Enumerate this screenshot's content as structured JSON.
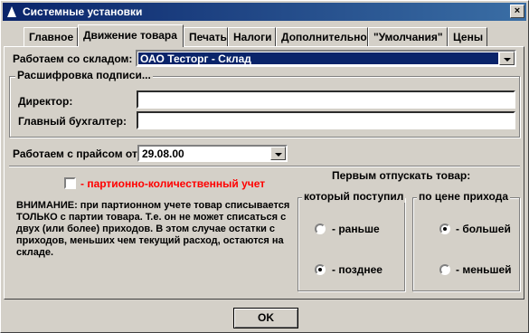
{
  "window": {
    "title": "Системные установки",
    "close_glyph": "×"
  },
  "tabs": [
    {
      "label": "Главное"
    },
    {
      "label": "Движение товара",
      "active": true
    },
    {
      "label": "Печать"
    },
    {
      "label": "Налоги"
    },
    {
      "label": "Дополнительно"
    },
    {
      "label": "\"Умолчания\""
    },
    {
      "label": "Цены"
    }
  ],
  "warehouse": {
    "label": "Работаем со складом:",
    "value": "ОАО Тесторг - Склад"
  },
  "signatures": {
    "legend": "Расшифровка подписи...",
    "director_label": "Директор:",
    "director_value": "",
    "accountant_label": "Главный бухгалтер:",
    "accountant_value": ""
  },
  "pricelist": {
    "label": "Работаем с прайсом от:",
    "value": "29.08.00"
  },
  "batch": {
    "label": "- партионно-количественный учет",
    "checked": false,
    "label_color": "#ff0000"
  },
  "note": "ВНИМАНИЕ: при партионном учете товар списывается ТОЛЬКО с партии товара. Т.е. он не может списаться с двух (или более) приходов. В этом случае остатки с приходов, меньших чем текущий расход, остаются на складе.",
  "release_first": {
    "heading": "Первым отпускать товар:",
    "arrival_group": {
      "legend": "который поступил",
      "options": [
        {
          "label": "- раньше",
          "checked": false
        },
        {
          "label": "- позднее",
          "checked": true
        }
      ]
    },
    "price_group": {
      "legend": "по цене прихода",
      "options": [
        {
          "label": "- большей",
          "checked": true
        },
        {
          "label": "- меньшей",
          "checked": false
        }
      ]
    }
  },
  "ok_label": "OK",
  "colors": {
    "titlebar": "#0a246a",
    "face": "#d4d0c8",
    "selection": "#0a246a",
    "warning": "#ff0000"
  }
}
